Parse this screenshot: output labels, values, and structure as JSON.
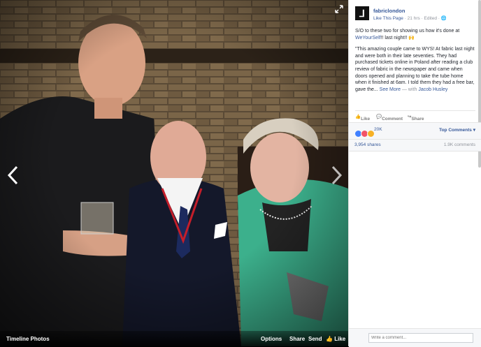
{
  "photo": {
    "album_label": "Timeline Photos",
    "actions": {
      "options": "Options",
      "share": "Share",
      "send": "Send",
      "like": "Like"
    }
  },
  "page": {
    "logo_glyph": "⅃",
    "name": "fabriclondon",
    "like_page": "Like This Page",
    "time": "21 hrs",
    "edited": "Edited"
  },
  "post": {
    "line1_pre": "S/O to these two for showing us how it's done at ",
    "line1_link": "WeYourSelf",
    "line1_post": "!! last night!! 🙌",
    "body": "\"This amazing couple came to WYS! At fabric last night and were both in their late seventies. They had purchased tickets online in Poland after reading a club review of fabric in the newspaper and came when doors opened and planning to take the tube home when it finished at 6am. I told them they had a free bar, gave the...",
    "see_more": "See More",
    "with": "with",
    "tag": "Jacob Husley"
  },
  "actions": {
    "like": "Like",
    "comment": "Comment",
    "share": "Share"
  },
  "reactions": {
    "count": "20K",
    "top_comments": "Top Comments",
    "shares": "3,954 shares",
    "comments": "1.9K comments",
    "colors": {
      "like": "#4080ff",
      "love": "#f25268",
      "wow": "#f7b125"
    }
  },
  "comment_box": {
    "placeholder": "Write a comment..."
  }
}
